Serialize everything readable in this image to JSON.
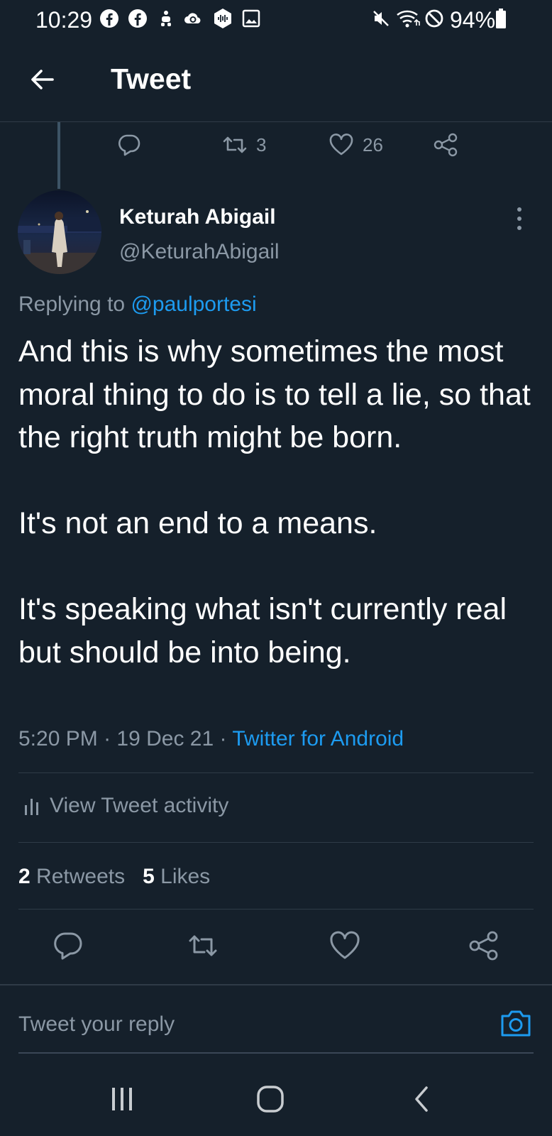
{
  "status_bar": {
    "time": "10:29",
    "battery": "94%",
    "left_icons": [
      "facebook-icon",
      "facebook-icon",
      "robot-icon",
      "cloud-sync-icon",
      "podcast-icon",
      "gallery-icon"
    ],
    "right_icons": [
      "mute-icon",
      "wifi-icon",
      "do-not-disturb-icon",
      "battery-icon"
    ]
  },
  "header": {
    "title": "Tweet"
  },
  "parent_tweet_actions": {
    "retweets": "3",
    "likes": "26"
  },
  "tweet": {
    "author_name": "Keturah Abigail",
    "author_handle": "@KeturahAbigail",
    "replying_prefix": "Replying to ",
    "replying_to": "@paulportesi",
    "text": "And this is why sometimes the most moral thing to do is to tell a lie, so that the right truth might be born.\n\nIt's not an end to a means.\n\nIt's speaking what isn't currently real but should be into being.",
    "time": "5:20 PM",
    "date": "19 Dec 21",
    "separator": "·",
    "source": "Twitter for Android"
  },
  "activity_label": "View Tweet activity",
  "stats": {
    "retweets_count": "2",
    "retweets_label": "Retweets",
    "likes_count": "5",
    "likes_label": "Likes"
  },
  "reply": {
    "placeholder": "Tweet your reply"
  },
  "colors": {
    "background": "#15202b",
    "accent": "#1d9bf0",
    "muted": "#8b98a5",
    "divider": "#2f3b47"
  }
}
